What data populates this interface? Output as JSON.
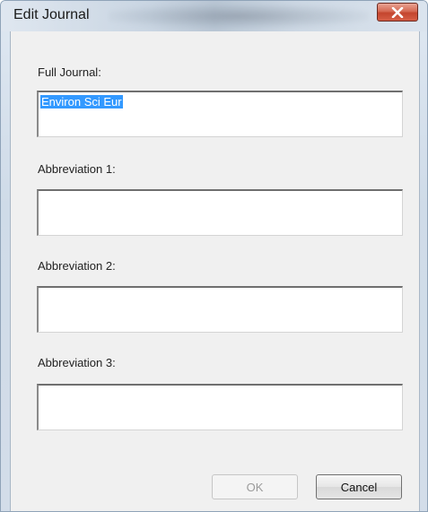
{
  "window": {
    "title": "Edit Journal",
    "close_icon": "close-icon"
  },
  "form": {
    "full_journal": {
      "label": "Full Journal:",
      "value": "Environ Sci Eur",
      "selected": true
    },
    "abbreviation_1": {
      "label": "Abbreviation 1:",
      "value": ""
    },
    "abbreviation_2": {
      "label": "Abbreviation 2:",
      "value": ""
    },
    "abbreviation_3": {
      "label": "Abbreviation 3:",
      "value": ""
    }
  },
  "buttons": {
    "ok_label": "OK",
    "ok_enabled": false,
    "cancel_label": "Cancel"
  },
  "colors": {
    "selection": "#3399ff",
    "close_button": "#c4452e",
    "dialog_background": "#f0f0f0"
  }
}
